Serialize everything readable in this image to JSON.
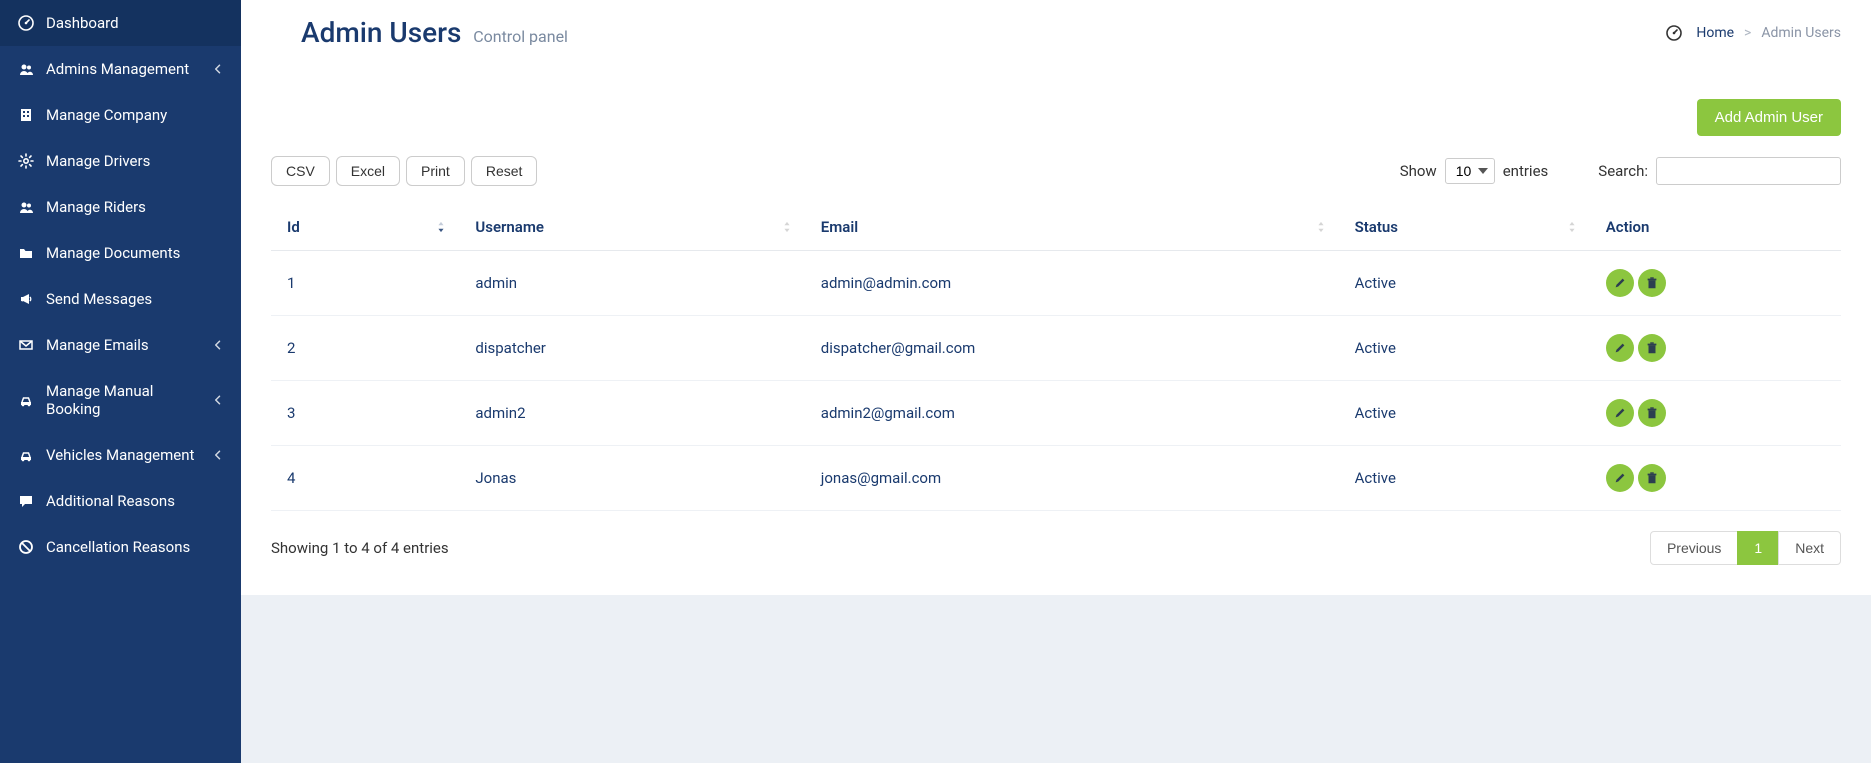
{
  "sidebar": {
    "items": [
      {
        "label": "Dashboard",
        "icon": "dashboard",
        "expandable": false
      },
      {
        "label": "Admins Management",
        "icon": "users",
        "expandable": true
      },
      {
        "label": "Manage Company",
        "icon": "building",
        "expandable": false
      },
      {
        "label": "Manage Drivers",
        "icon": "gear",
        "expandable": false
      },
      {
        "label": "Manage Riders",
        "icon": "users",
        "expandable": false
      },
      {
        "label": "Manage Documents",
        "icon": "folder",
        "expandable": false
      },
      {
        "label": "Send Messages",
        "icon": "bullhorn",
        "expandable": false
      },
      {
        "label": "Manage Emails",
        "icon": "envelope",
        "expandable": true
      },
      {
        "label": "Manage Manual Booking",
        "icon": "car",
        "expandable": true
      },
      {
        "label": "Vehicles Management",
        "icon": "car",
        "expandable": true
      },
      {
        "label": "Additional Reasons",
        "icon": "comment",
        "expandable": false
      },
      {
        "label": "Cancellation Reasons",
        "icon": "ban",
        "expandable": false
      }
    ]
  },
  "header": {
    "title": "Admin Users",
    "subtitle": "Control panel",
    "breadcrumb_home": "Home",
    "breadcrumb_current": "Admin Users"
  },
  "actions": {
    "add_button": "Add Admin User"
  },
  "toolbar": {
    "csv": "CSV",
    "excel": "Excel",
    "print": "Print",
    "reset": "Reset",
    "show_label": "Show",
    "entries_label": "entries",
    "length_value": "10",
    "search_label": "Search:",
    "search_value": ""
  },
  "table": {
    "columns": {
      "id": "Id",
      "username": "Username",
      "email": "Email",
      "status": "Status",
      "action": "Action"
    },
    "rows": [
      {
        "id": "1",
        "username": "admin",
        "email": "admin@admin.com",
        "status": "Active"
      },
      {
        "id": "2",
        "username": "dispatcher",
        "email": "dispatcher@gmail.com",
        "status": "Active"
      },
      {
        "id": "3",
        "username": "admin2",
        "email": "admin2@gmail.com",
        "status": "Active"
      },
      {
        "id": "4",
        "username": "Jonas",
        "email": "jonas@gmail.com",
        "status": "Active"
      }
    ]
  },
  "footer": {
    "info": "Showing 1 to 4 of 4 entries",
    "previous": "Previous",
    "page": "1",
    "next": "Next"
  }
}
